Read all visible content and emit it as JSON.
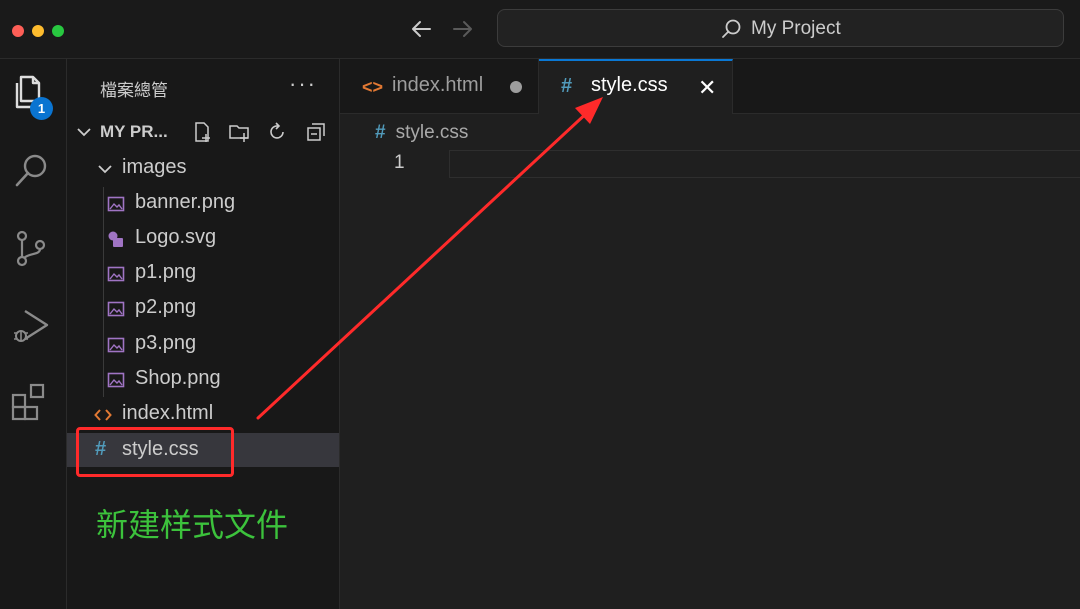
{
  "window": {
    "search_text": "My Project"
  },
  "activity_bar": {
    "explorer_badge": "1"
  },
  "sidebar": {
    "title": "檔案總管",
    "more": "···",
    "folder_name": "MY PR...",
    "tree": [
      {
        "label": "images",
        "kind": "folder"
      },
      {
        "label": "banner.png",
        "kind": "image"
      },
      {
        "label": "Logo.svg",
        "kind": "svg"
      },
      {
        "label": "p1.png",
        "kind": "image"
      },
      {
        "label": "p2.png",
        "kind": "image"
      },
      {
        "label": "p3.png",
        "kind": "image"
      },
      {
        "label": "Shop.png",
        "kind": "image"
      },
      {
        "label": "index.html",
        "kind": "html"
      },
      {
        "label": "style.css",
        "kind": "css",
        "selected": true
      }
    ]
  },
  "tabs": [
    {
      "label": "index.html",
      "icon": "<>",
      "state": "modified"
    },
    {
      "label": "style.css",
      "icon": "#",
      "state": "active",
      "close": "✕"
    }
  ],
  "editor": {
    "breadcrumb_icon": "#",
    "breadcrumb": "style.css",
    "line_number": "1"
  },
  "annotation": {
    "text": "新建样式文件"
  },
  "colors": {
    "accent": "#0a78d4",
    "annotation_red": "#ff2a2a",
    "annotation_green": "#3cc23c",
    "css_icon": "#519aba",
    "html_icon": "#e37933",
    "image_icon": "#a074c4"
  }
}
